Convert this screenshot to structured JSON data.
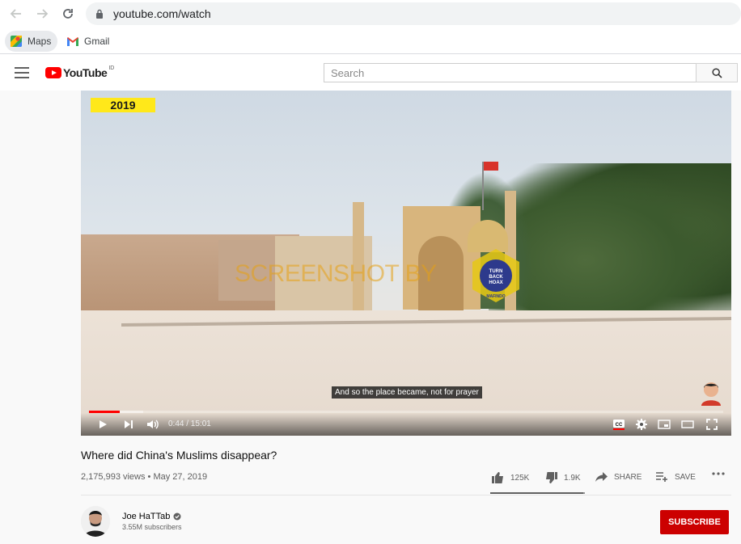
{
  "browser": {
    "url": "youtube.com/watch",
    "bookmarks": [
      {
        "label": "Maps",
        "icon": "maps-icon"
      },
      {
        "label": "Gmail",
        "icon": "gmail-icon"
      }
    ]
  },
  "header": {
    "logo_text": "YouTube",
    "logo_country": "ID",
    "search_placeholder": "Search"
  },
  "player": {
    "year_tag": "2019",
    "watermark_text": "SCREENSHOT BY",
    "watermark_badge": "TURN BACK HOAX · MAFINDO",
    "subtitle": "And so the place became, not for prayer",
    "time_current": "0:44",
    "time_total": "15:01",
    "time_display": "0:44 / 15:01",
    "progress_played": 0.049,
    "progress_loaded": 0.085,
    "accent_color": "#ff0000"
  },
  "video": {
    "title": "Where did China's Muslims disappear?",
    "meta": "2,175,993 views • May 27, 2019",
    "likes": "125K",
    "dislikes": "1.9K",
    "share_label": "SHARE",
    "save_label": "SAVE",
    "like_ratio": 0.985
  },
  "channel": {
    "name": "Joe HaTTab",
    "subscribers": "3.55M subscribers",
    "subscribe_label": "SUBSCRIBE",
    "subscribe_color": "#cc0000"
  }
}
